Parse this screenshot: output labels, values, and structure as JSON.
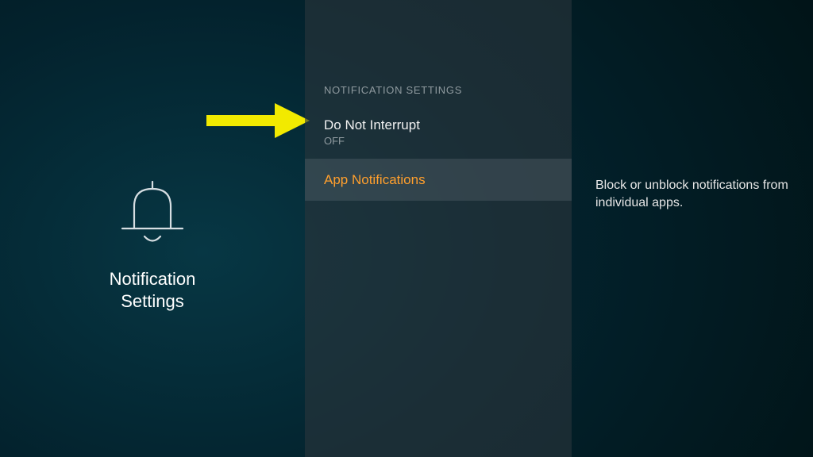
{
  "left": {
    "section_title_line1": "Notification",
    "section_title_line2": "Settings",
    "icon": "bell-icon"
  },
  "middle": {
    "header": "NOTIFICATION SETTINGS",
    "items": [
      {
        "label": "Do Not Interrupt",
        "sublabel": "OFF"
      },
      {
        "label": "App Notifications"
      }
    ]
  },
  "right": {
    "description": "Block or unblock notifications from individual apps."
  },
  "annotation": {
    "arrow_color": "#f2ea00"
  }
}
